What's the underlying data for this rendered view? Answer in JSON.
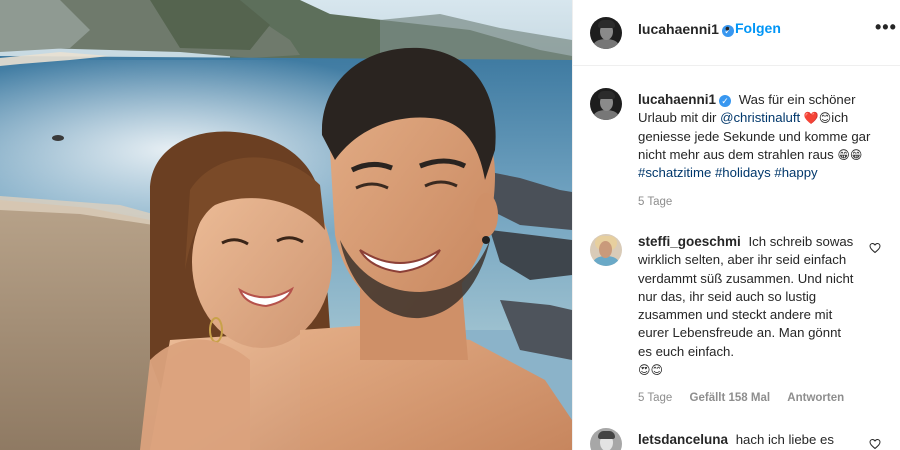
{
  "post": {
    "username": "lucahaenni1",
    "follow_label": "Folgen",
    "more_label": "•••",
    "dot": "•"
  },
  "caption": {
    "username": "lucahaenni1",
    "text_1": "Was für ein schöner Urlaub mit dir ",
    "mention": "@christinaluft",
    "emoji_1": "❤️😊",
    "text_2": "ich geniesse jede Sekunde und komme gar nicht mehr aus dem strahlen raus ",
    "emoji_2": "😁😁",
    "tags": [
      "#schatzitime",
      "#holidays",
      "#happy"
    ],
    "time": "5 Tage"
  },
  "comments": [
    {
      "username": "steffi_goeschmi",
      "text": "Ich schreib sowas wirklich selten, aber ihr seid einfach verdammt süß zusammen. Und nicht nur das, ihr seid auch so lustig zusammen und steckt andere mit eurer Lebensfreude an. Man gönnt es euch einfach.",
      "emoji": "😍😊",
      "time": "5 Tage",
      "likes": "Gefällt 158 Mal",
      "reply": "Antworten"
    },
    {
      "username": "letsdanceluna",
      "text": "hach ich liebe es"
    }
  ],
  "icons": {
    "verified": "verified-badge-icon",
    "like": "heart-icon",
    "more": "more-options-icon"
  },
  "colors": {
    "link": "#00376b",
    "follow": "#0095f6",
    "verified": "#3897f0",
    "muted": "#8e8e8e"
  }
}
